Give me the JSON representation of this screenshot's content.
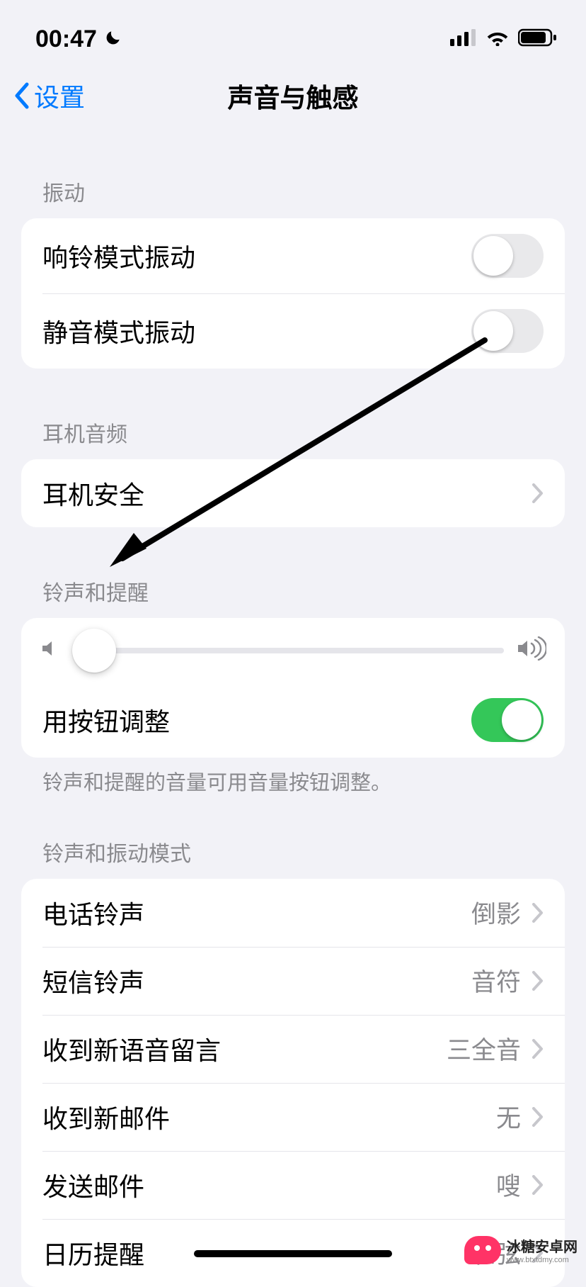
{
  "status": {
    "time": "00:47"
  },
  "nav": {
    "back": "设置",
    "title": "声音与触感"
  },
  "sections": {
    "vibration": {
      "header": "振动",
      "ring": "响铃模式振动",
      "silent": "静音模式振动",
      "ring_on": false,
      "silent_on": false
    },
    "headphone": {
      "header": "耳机音频",
      "safety": "耳机安全"
    },
    "ringer": {
      "header": "铃声和提醒",
      "slider_value": 3,
      "with_buttons": "用按钮调整",
      "with_buttons_on": true,
      "footer": "铃声和提醒的音量可用音量按钮调整。"
    },
    "sounds": {
      "header": "铃声和振动模式",
      "items": [
        {
          "label": "电话铃声",
          "value": "倒影"
        },
        {
          "label": "短信铃声",
          "value": "音符"
        },
        {
          "label": "收到新语音留言",
          "value": "三全音"
        },
        {
          "label": "收到新邮件",
          "value": "无"
        },
        {
          "label": "发送邮件",
          "value": "嗖"
        },
        {
          "label": "日历提醒",
          "value": "和弦"
        }
      ]
    }
  },
  "watermark": {
    "name": "冰糖安卓网",
    "url": "www.btxtdmy.com"
  }
}
